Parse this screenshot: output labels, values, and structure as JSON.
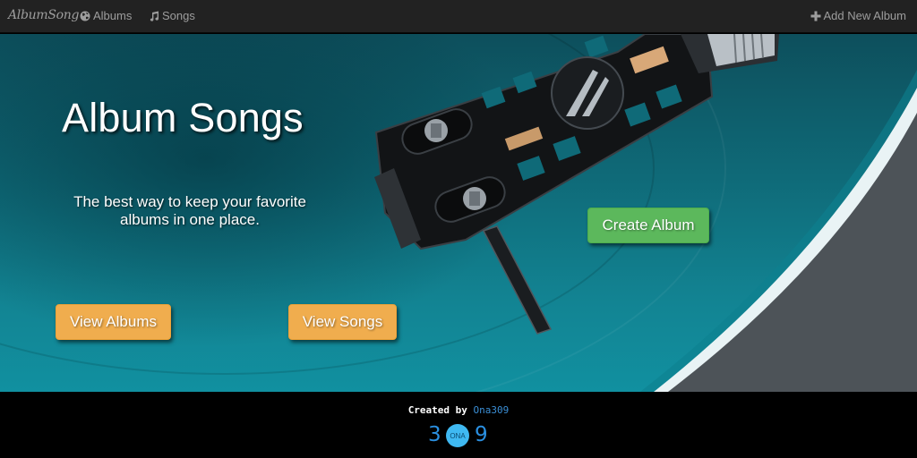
{
  "navbar": {
    "brand": "AlbumSong",
    "albums_label": "Albums",
    "songs_label": "Songs",
    "add_label": "Add New Album"
  },
  "hero": {
    "title": "Album Songs",
    "tagline": "The best way to keep your favorite albums in one place.",
    "create_button": "Create Album",
    "view_albums_button": "View Albums",
    "view_songs_button": "View Songs"
  },
  "footer": {
    "credit_prefix": "Created by",
    "credit_author": "Ona309",
    "logo_left": "3",
    "logo_center": "ONA",
    "logo_right": "9"
  },
  "colors": {
    "navbar_bg": "#222222",
    "success": "#5cb85c",
    "warning": "#f0ad4e",
    "hero_teal": "#128493",
    "link_blue": "#3b8fd6"
  },
  "icons": {
    "albums": "globe-icon",
    "songs": "music-note-icon",
    "add": "plus-icon"
  }
}
